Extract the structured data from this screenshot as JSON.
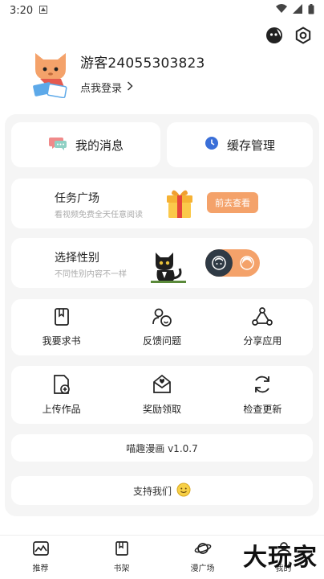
{
  "status_bar": {
    "time": "3:20"
  },
  "profile": {
    "username": "游客24055303823",
    "login_label": "点我登录"
  },
  "messages": {
    "label": "我的消息"
  },
  "cache": {
    "label": "缓存管理"
  },
  "task": {
    "title": "任务广场",
    "subtitle": "看视频免费全天任意阅读",
    "button": "前去查看"
  },
  "gender": {
    "title": "选择性别",
    "subtitle": "不同性别内容不一样"
  },
  "grid1": [
    {
      "label": "我要求书",
      "icon": "book-request-icon"
    },
    {
      "label": "反馈问题",
      "icon": "feedback-icon"
    },
    {
      "label": "分享应用",
      "icon": "share-icon"
    }
  ],
  "grid2": [
    {
      "label": "上传作品",
      "icon": "upload-icon"
    },
    {
      "label": "奖励领取",
      "icon": "reward-icon"
    },
    {
      "label": "检查更新",
      "icon": "refresh-icon"
    }
  ],
  "version": {
    "text": "喵趣漫画 v1.0.7"
  },
  "support": {
    "text": "支持我们"
  },
  "nav": [
    {
      "label": "推荐",
      "icon": "recommend-icon"
    },
    {
      "label": "书架",
      "icon": "bookshelf-icon"
    },
    {
      "label": "漫广场",
      "icon": "planet-icon"
    },
    {
      "label": "我的",
      "icon": "profile-icon"
    }
  ],
  "watermark": "大玩家",
  "colors": {
    "accent": "#f4a26a",
    "dark": "#2f3a45",
    "panel_bg": "#f5f5f5"
  }
}
